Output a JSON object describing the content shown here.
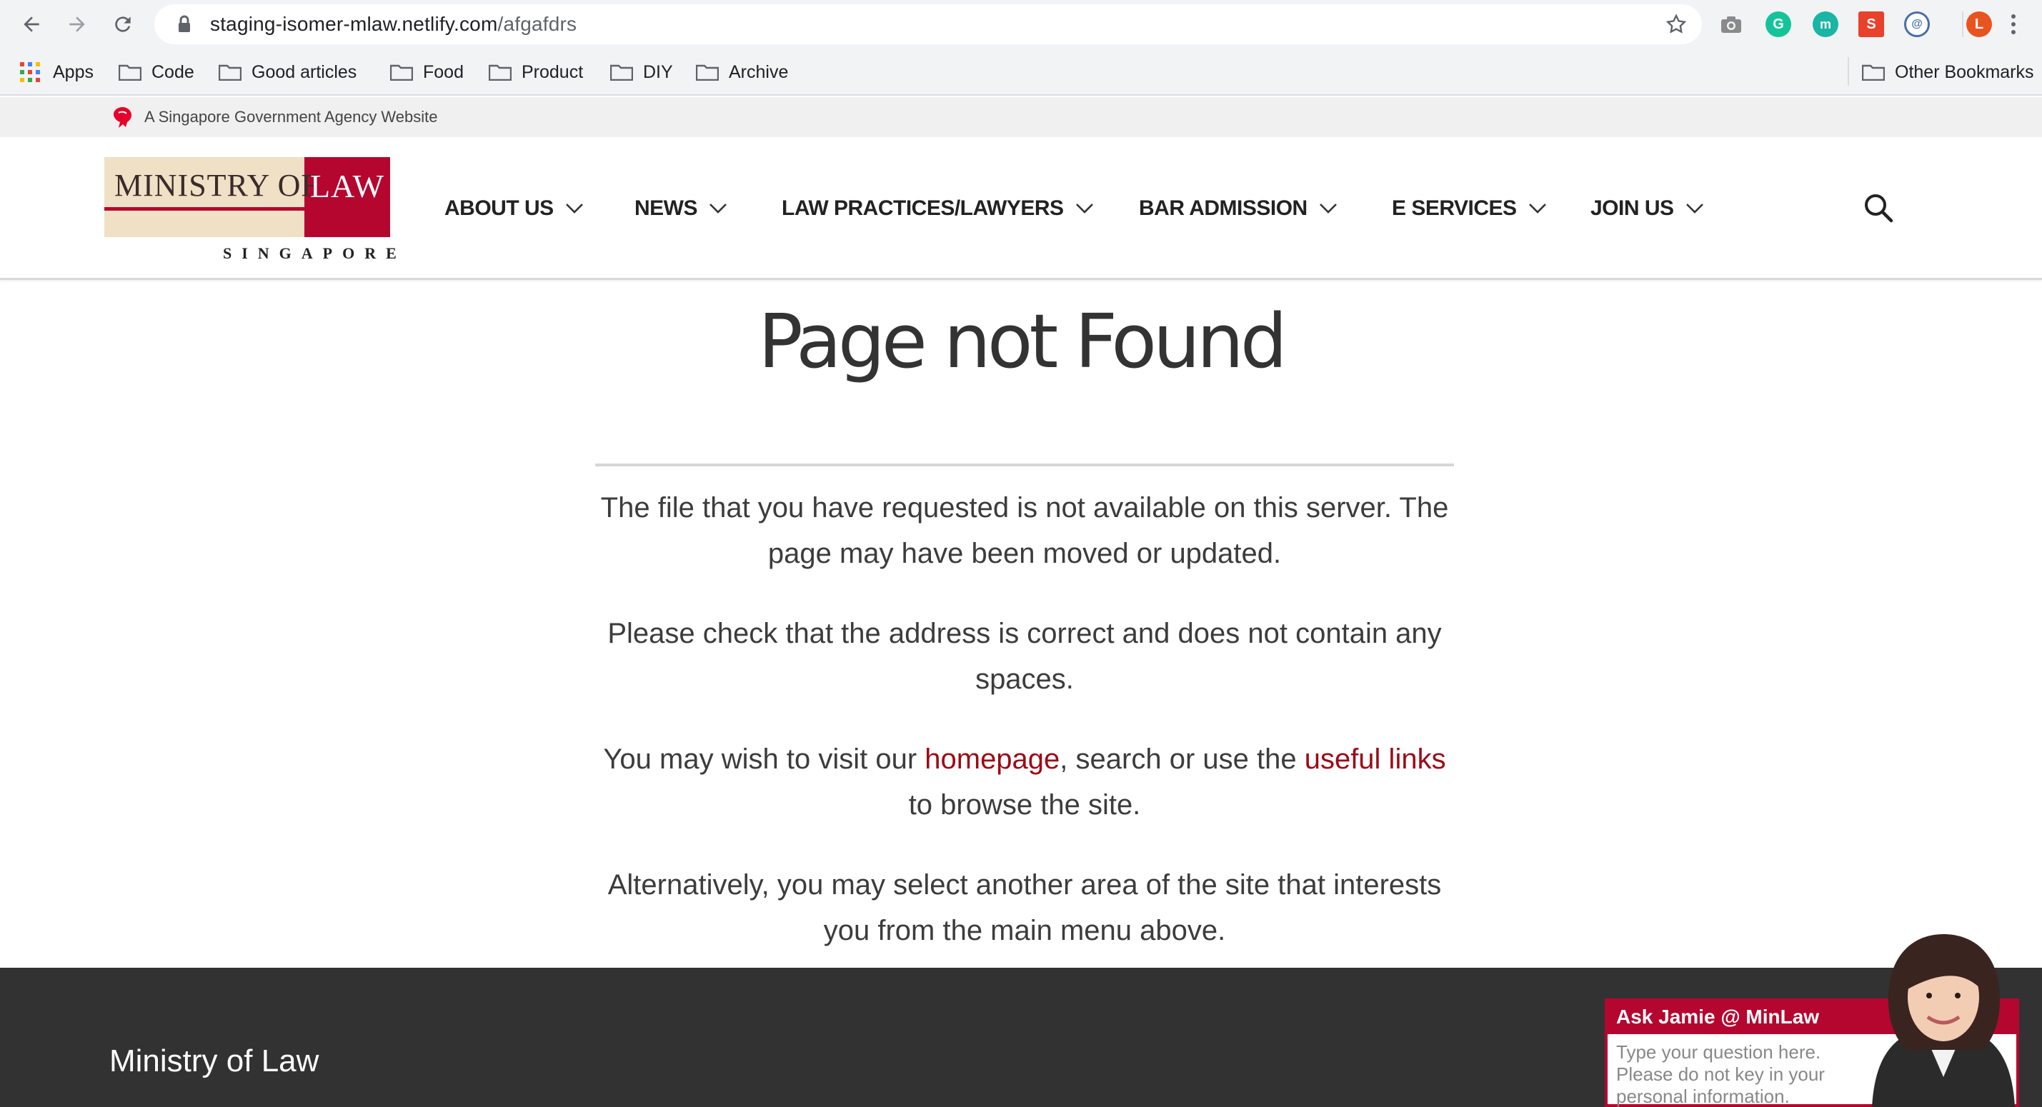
{
  "browser": {
    "url_host": "staging-isomer-mlaw.netlify.com",
    "url_path": "/afgafdrs",
    "profile_initial": "L",
    "bookmarks": [
      "Apps",
      "Code",
      "Good articles",
      "Food",
      "Product",
      "DIY",
      "Archive"
    ],
    "other_bookmarks": "Other Bookmarks"
  },
  "masthead": {
    "text": "A Singapore Government Agency Website"
  },
  "logo": {
    "ministry": "MINISTRY OF",
    "law": "LAW",
    "country": "SINGAPORE"
  },
  "nav": {
    "items": [
      "ABOUT US",
      "NEWS",
      "LAW PRACTICES/LAWYERS",
      "BAR ADMISSION",
      "E SERVICES",
      "JOIN US"
    ]
  },
  "content": {
    "title": "Page not Found",
    "p1": "The file that you have requested is not available on this server. The page may have been moved or updated.",
    "p2": "Please check that the address is correct and does not contain any spaces.",
    "p3_prefix": "You may wish to visit our ",
    "p3_link1": "homepage",
    "p3_middle": ", search or use the ",
    "p3_link2": "useful links",
    "p3_suffix": " to browse the site.",
    "p4": "Alternatively, you may select another area of the site that interests you from the main menu above."
  },
  "footer": {
    "brand": "Ministry of Law"
  },
  "chat": {
    "title": "Ask Jamie @ MinLaw",
    "placeholder": "Type your question here. Please do not key in your personal information."
  },
  "colors": {
    "brand_red": "#b5062f",
    "link_red": "#9c0a16",
    "footer_bg": "#323232"
  }
}
